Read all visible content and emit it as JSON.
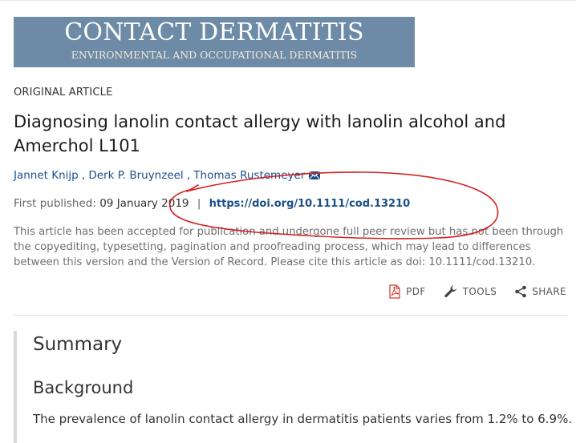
{
  "journal": {
    "name": "CONTACT DERMATITIS",
    "subtitle": "ENVIRONMENTAL AND OCCUPATIONAL DERMATITIS",
    "banner_color": "#6d8ba6"
  },
  "article": {
    "type_label": "ORIGINAL ARTICLE",
    "title": "Diagnosing lanolin contact allergy with lanolin alcohol and Amerchol L101",
    "authors": [
      "Jannet Knijp",
      "Derk P. Bruynzeel",
      "Thomas Rustemeyer"
    ],
    "published_label": "First published:",
    "published_date": "09 January 2019",
    "separator": "|",
    "doi": "https://doi.org/10.1111/cod.13210",
    "notice": "This article has been accepted for publication and undergone full peer review but has not been through the copyediting, typesetting, pagination and proofreading process, which may lead to differences between this version and the Version of Record. Please cite this article as doi: 10.1111/cod.13210."
  },
  "toolbar": {
    "pdf": "PDF",
    "tools": "TOOLS",
    "share": "SHARE"
  },
  "abstract": {
    "summary_heading": "Summary",
    "background_heading": "Background",
    "text": "The prevalence of lanolin contact allergy in dermatitis patients varies from 1.2% to 6.9%."
  },
  "colors": {
    "link": "#1b4f8a",
    "annotation": "#d42020"
  }
}
